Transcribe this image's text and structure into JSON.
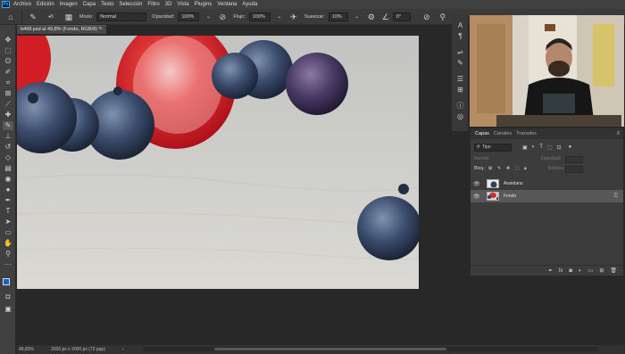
{
  "menu": {
    "logo": "Ps",
    "items": [
      "Archivo",
      "Edición",
      "Imagen",
      "Capa",
      "Texto",
      "Selección",
      "Filtro",
      "3D",
      "Vista",
      "Plugins",
      "Ventana",
      "Ayuda"
    ]
  },
  "options": {
    "brush_size": "5",
    "mode_label": "Modo:",
    "mode_value": "Normal",
    "opacity_label": "Opacidad:",
    "opacity_value": "100%",
    "flow_label": "Flujo:",
    "flow_value": "100%",
    "smoothing_label": "Suavizar:",
    "smoothing_value": "10%",
    "angle_value": "0°"
  },
  "document": {
    "tab_title": "b468.psd al 49,8% (Fondo, RGB/8) *"
  },
  "status": {
    "zoom": "49,83%",
    "info": "2020 px x 2000 px (72 ppp)",
    "arrow": "›"
  },
  "layers_panel": {
    "tabs": [
      "Capas",
      "Canales",
      "Trazados"
    ],
    "filter_value": "Tipo",
    "mode_value": "Normal",
    "opacity_label": "Opacidad:",
    "lock_label": "Bloq.:",
    "fill_label": "Relleno:",
    "layers": [
      {
        "name": "Arandano",
        "visible": true,
        "selected": false,
        "locked": false
      },
      {
        "name": "Fondo",
        "visible": true,
        "selected": true,
        "locked": true
      }
    ]
  },
  "colors": {
    "accent": "#31a8ff",
    "foreground": "#1d5bd3",
    "background": "#ffffff"
  }
}
